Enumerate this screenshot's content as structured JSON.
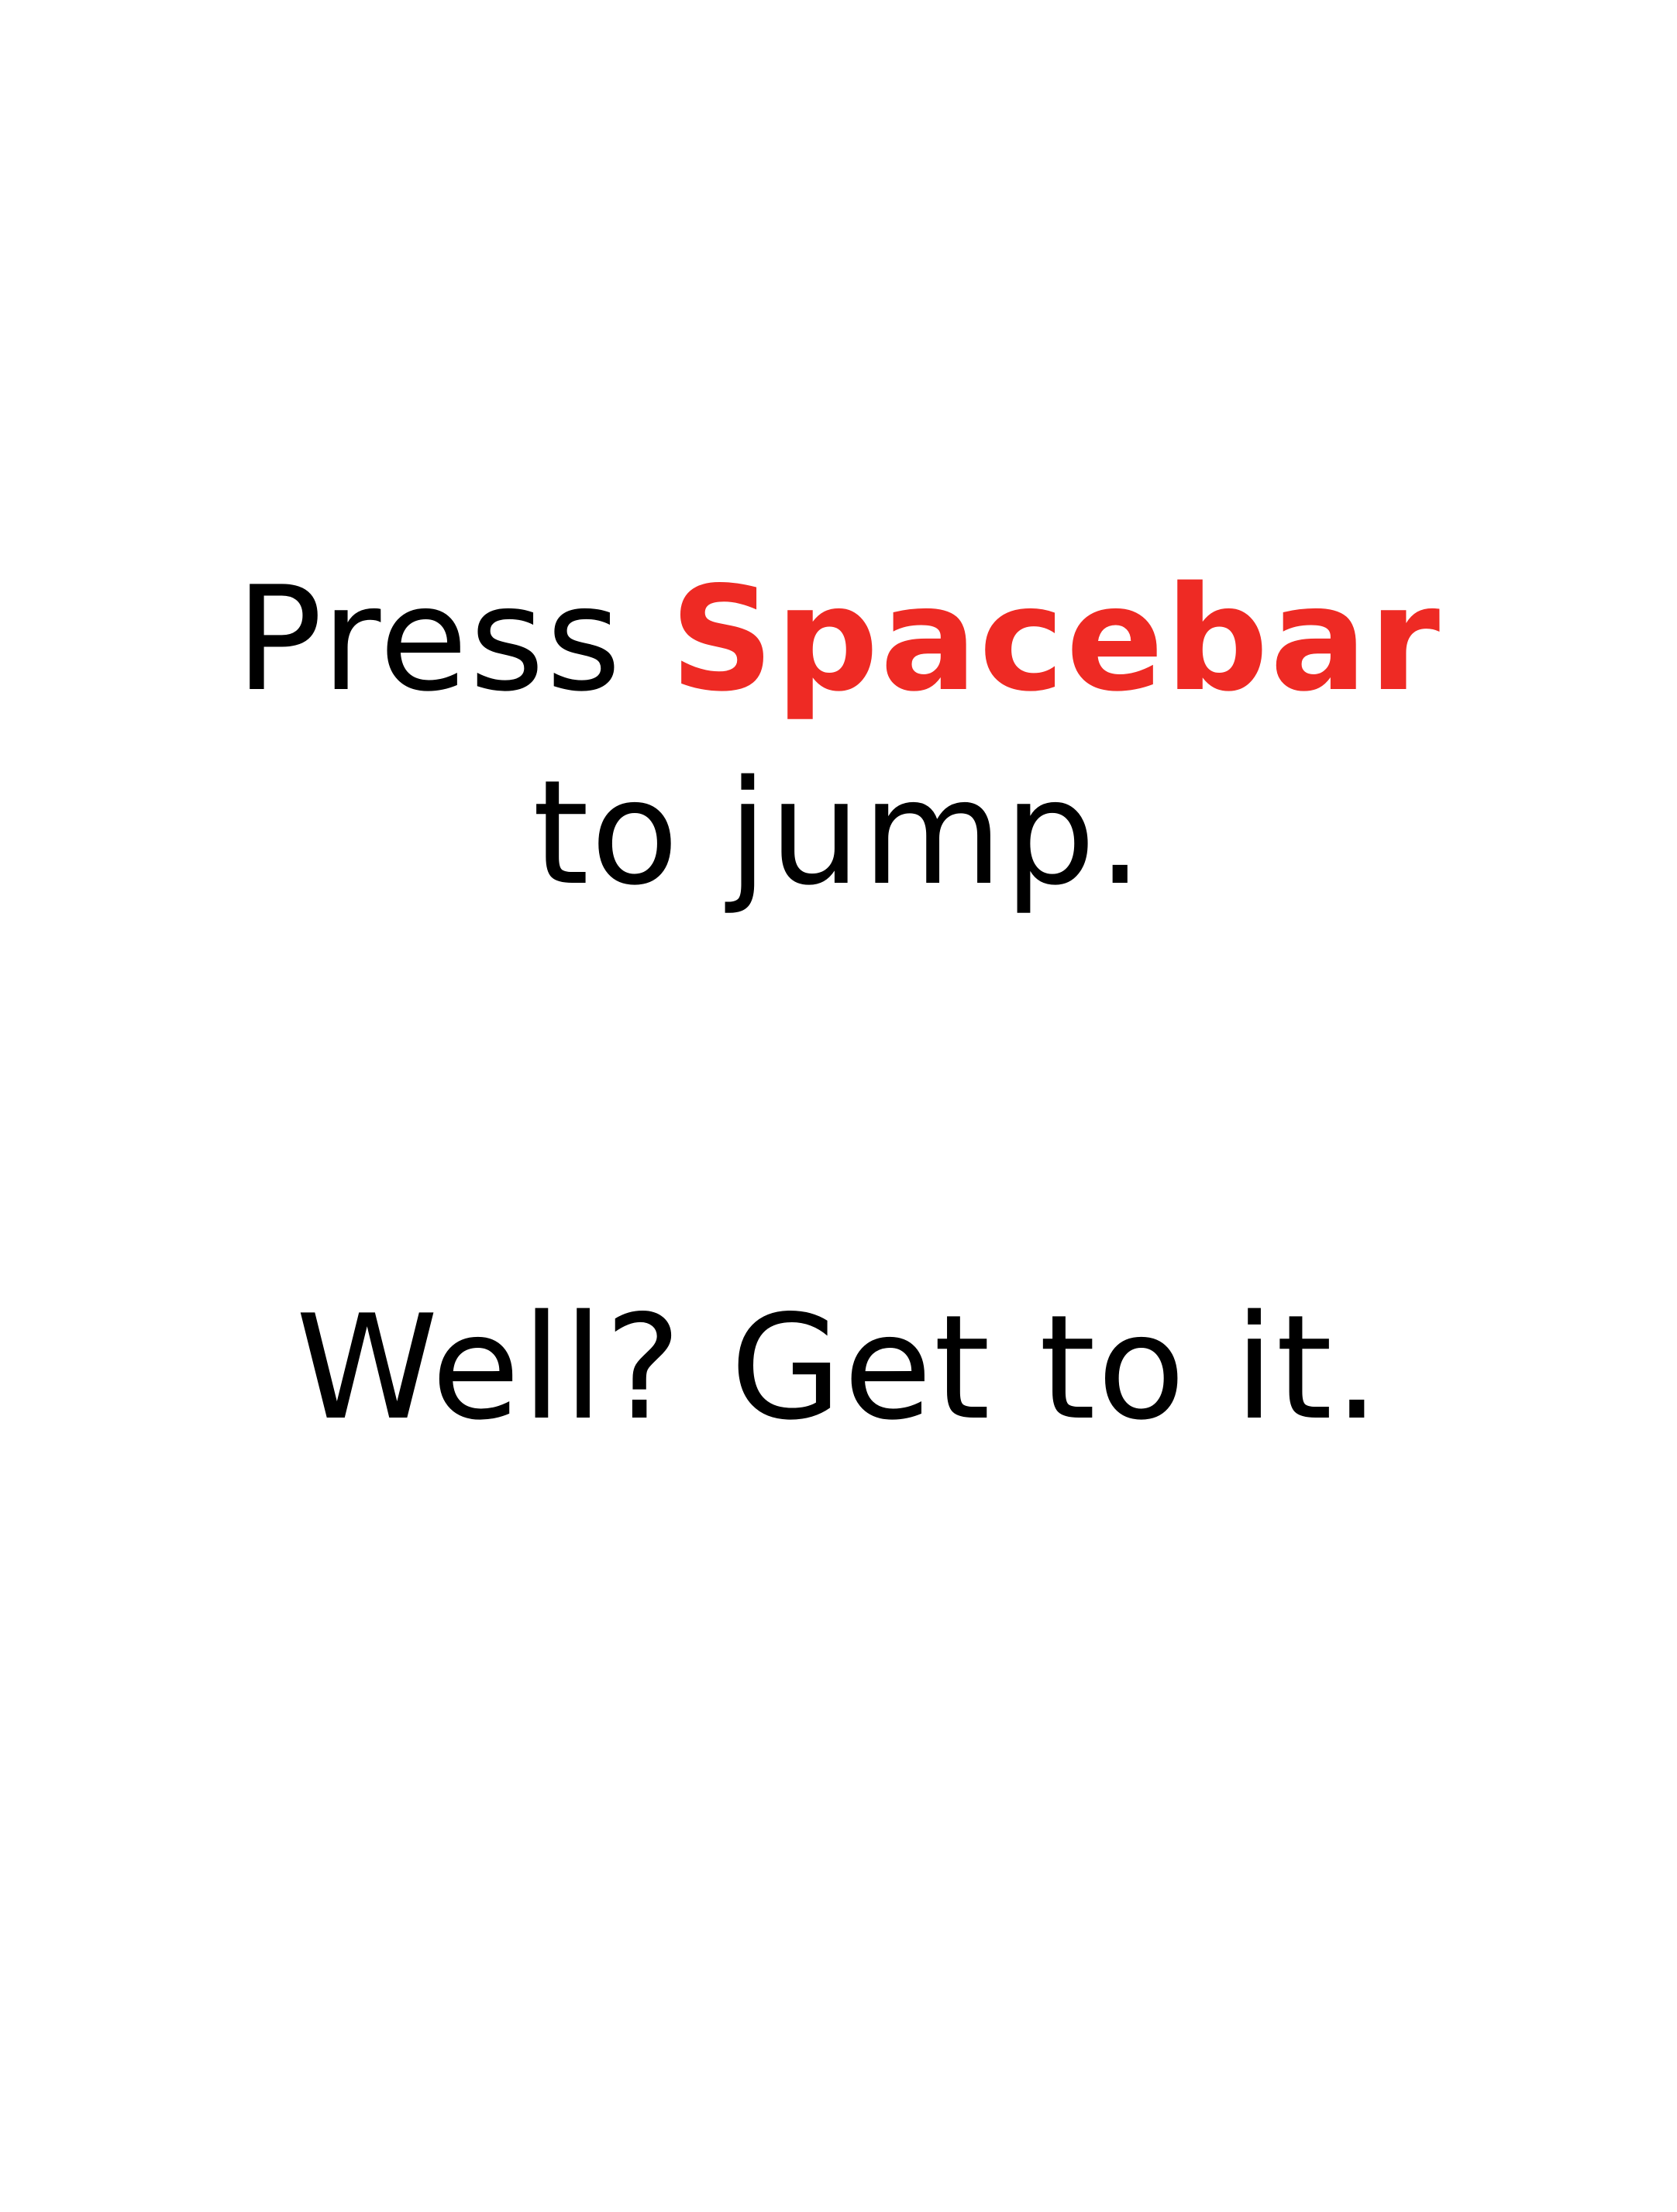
{
  "instruction": {
    "prefix": "Press",
    "key": "Spacebar",
    "line2": "to jump."
  },
  "taunt": {
    "text": "Well? Get to it."
  },
  "colors": {
    "background": "#ffffff",
    "text": "#000000",
    "key_highlight": "#ee2a24"
  }
}
